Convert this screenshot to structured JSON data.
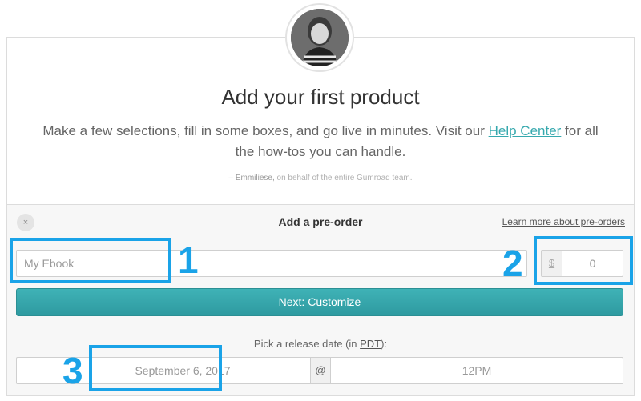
{
  "header": {
    "title": "Add your first product",
    "description_before": "Make a few selections, fill in some boxes, and go live in minutes. Visit our ",
    "help_link": "Help Center",
    "description_after": " for all the how-tos you can handle.",
    "signature_name": "– Emmiliese,",
    "signature_rest": " on behalf of the entire Gumroad team."
  },
  "panel": {
    "close_icon": "×",
    "title": "Add a pre-order",
    "learn_link": "Learn more about pre-orders"
  },
  "form": {
    "name_placeholder": "My Ebook",
    "currency": "$",
    "price_placeholder": "0",
    "next_button": "Next: Customize",
    "release_label_before": "Pick a release date (in ",
    "release_label_tz": "PDT",
    "release_label_after": "):",
    "date_value": "September 6, 2017",
    "at_separator": "@",
    "time_value": "12PM"
  },
  "annotations": {
    "n1": "1",
    "n2": "2",
    "n3": "3",
    "color": "#1aa3e8"
  },
  "colors": {
    "accent": "#36a9ae",
    "button": "#3aa8ad"
  }
}
